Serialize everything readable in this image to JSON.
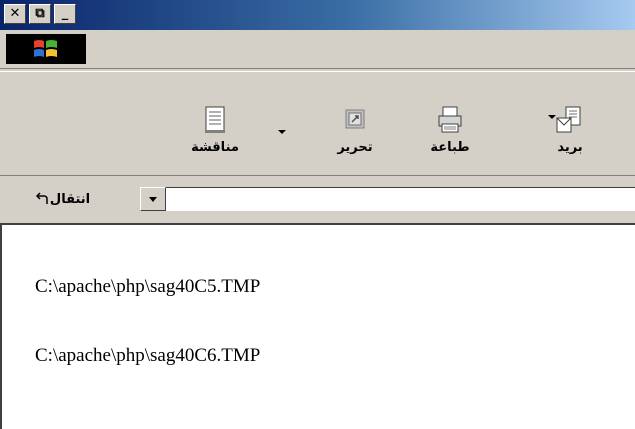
{
  "window": {
    "caption_buttons": [
      {
        "name": "close",
        "glyph": "✕"
      },
      {
        "name": "restore",
        "glyph": "⧉"
      },
      {
        "name": "minimize",
        "glyph": "_"
      }
    ]
  },
  "brand": {
    "logo_icon": "windows-flag-icon"
  },
  "toolbar": {
    "buttons": [
      {
        "label": "بريد",
        "icon": "mail-icon",
        "has_dropdown": true
      },
      {
        "label": "طباعة",
        "icon": "printer-icon",
        "has_dropdown": false
      },
      {
        "label": "تحرير",
        "icon": "edit-icon",
        "has_dropdown": false
      },
      {
        "label": "مناقشة",
        "icon": "discuss-icon",
        "has_dropdown": true
      }
    ]
  },
  "address": {
    "go_label": "انتقال",
    "go_icon": "go-arrow-icon",
    "value": ""
  },
  "content": {
    "lines": [
      "C:\\apache\\php\\sag40C5.TMP",
      "C:\\apache\\php\\sag40C6.TMP"
    ]
  },
  "colors": {
    "title_gradient_start": "#0a246a",
    "title_gradient_end": "#a6caf0",
    "chrome": "#d4d0c8",
    "content_bg": "#ffffff"
  }
}
